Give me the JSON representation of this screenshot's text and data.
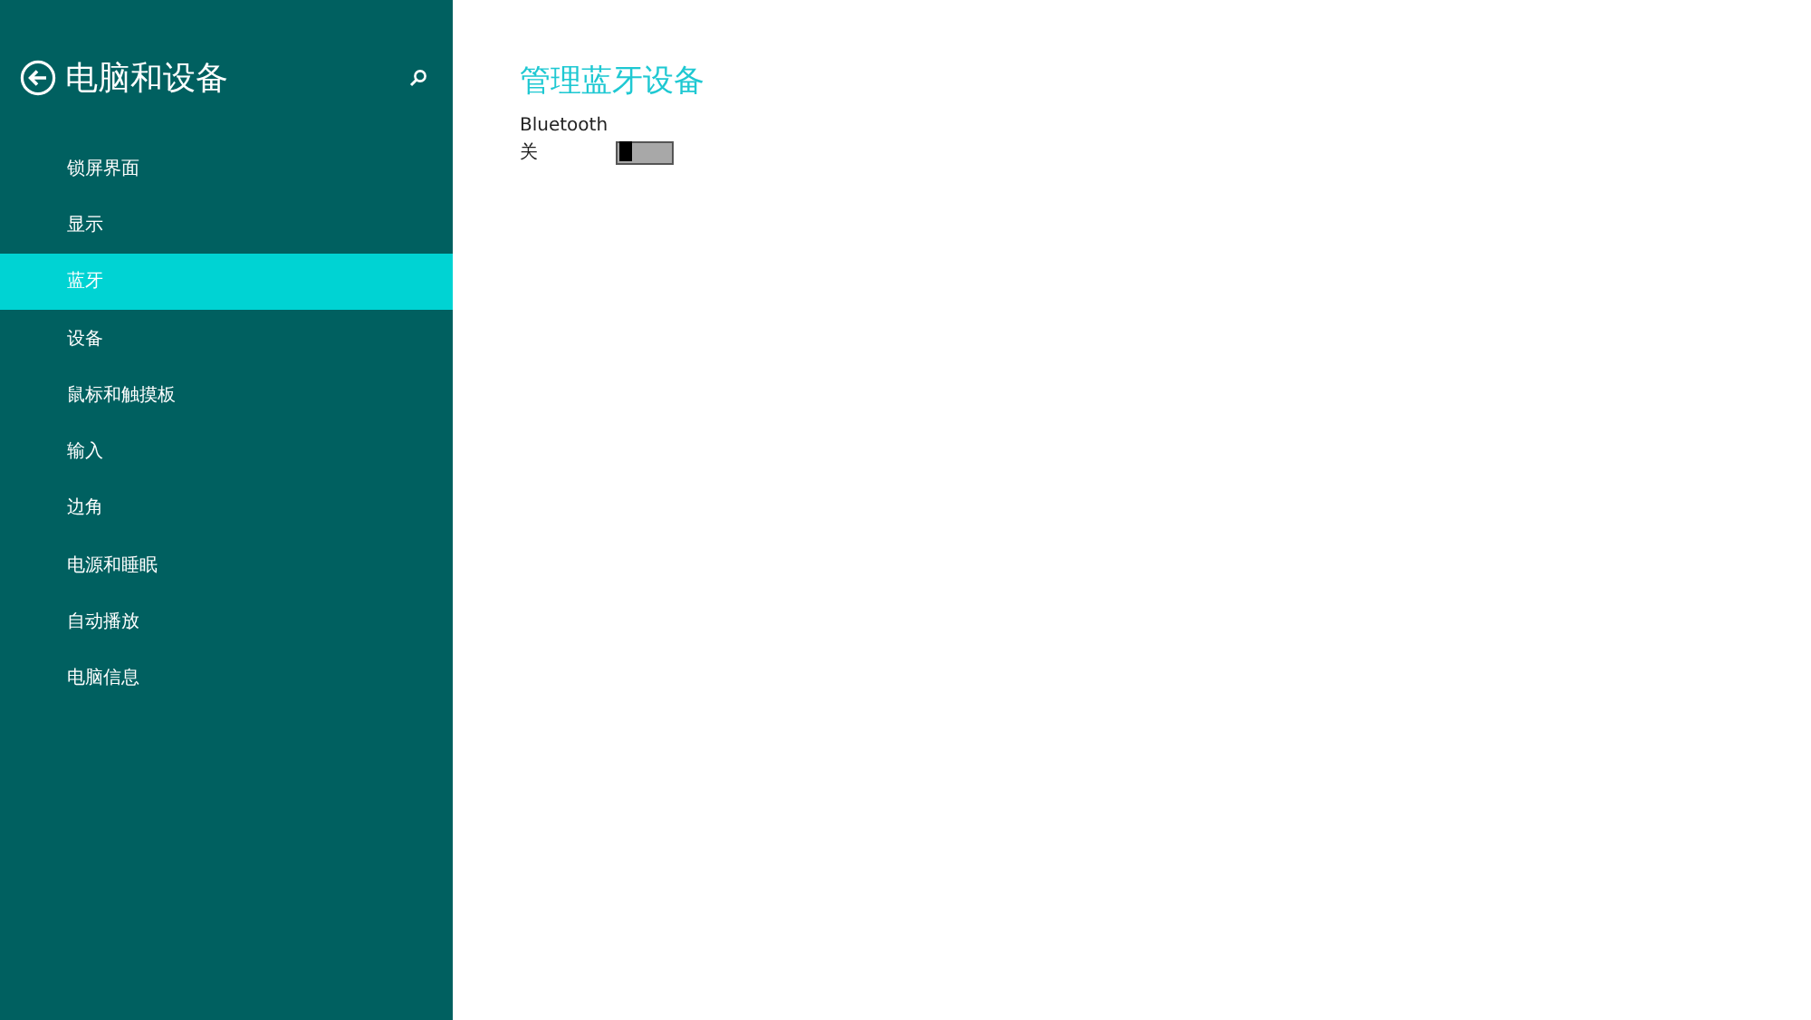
{
  "sidebar": {
    "title": "电脑和设备",
    "items": [
      {
        "label": "锁屏界面",
        "selected": false
      },
      {
        "label": "显示",
        "selected": false
      },
      {
        "label": "蓝牙",
        "selected": true
      },
      {
        "label": "设备",
        "selected": false
      },
      {
        "label": "鼠标和触摸板",
        "selected": false
      },
      {
        "label": "输入",
        "selected": false
      },
      {
        "label": "边角",
        "selected": false
      },
      {
        "label": "电源和睡眠",
        "selected": false
      },
      {
        "label": "自动播放",
        "selected": false
      },
      {
        "label": "电脑信息",
        "selected": false
      }
    ]
  },
  "main": {
    "heading": "管理蓝牙设备",
    "setting": {
      "label": "Bluetooth",
      "state_text": "关",
      "on": false
    }
  }
}
